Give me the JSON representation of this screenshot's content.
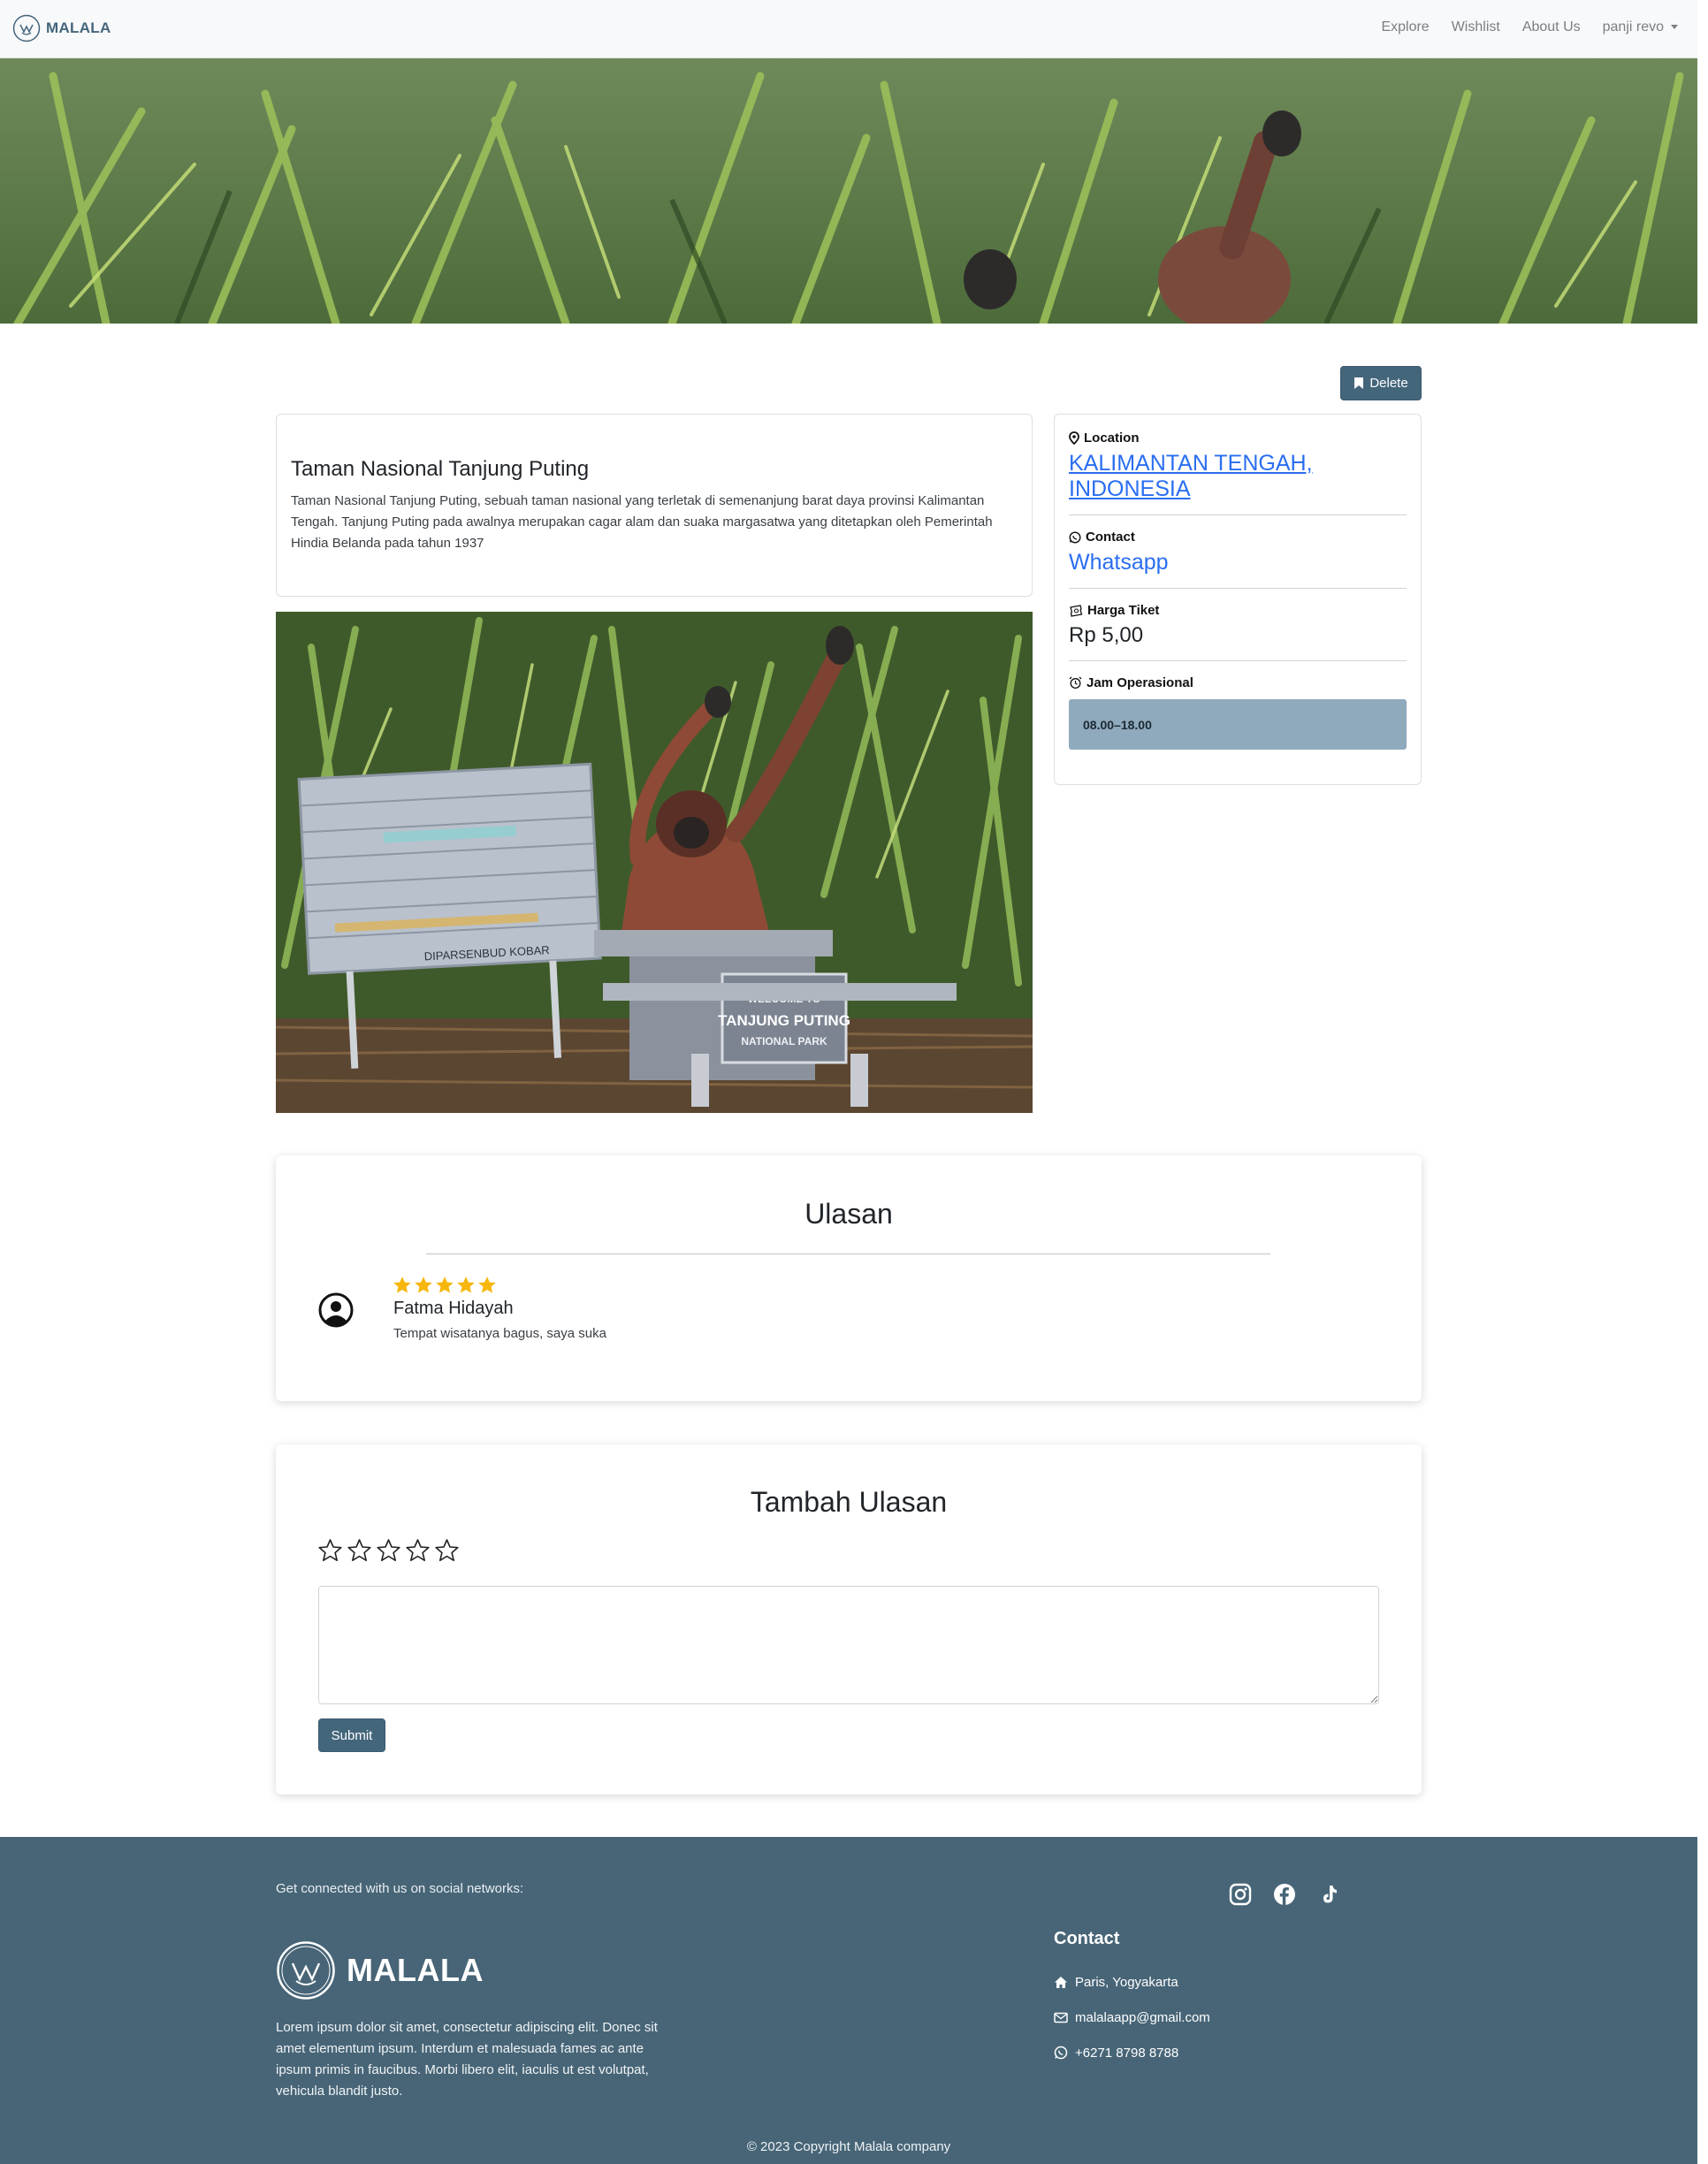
{
  "navbar": {
    "brand": "MALALA",
    "links": [
      "Explore",
      "Wishlist",
      "About Us"
    ],
    "user": "panji revo"
  },
  "actions": {
    "delete_label": "Delete"
  },
  "place": {
    "title": "Taman Nasional Tanjung Puting",
    "description": "Taman Nasional Tanjung Puting, sebuah taman nasional yang terletak di semenanjung barat daya provinsi Kalimantan Tengah. Tanjung Puting pada awalnya merupakan cagar alam dan suaka margasatwa yang ditetapkan oleh Pemerintah Hindia Belanda pada tahun 1937",
    "photo_sign_lines": [
      "WELCOME TO",
      "TANJUNG PUTING",
      "NATIONAL PARK"
    ],
    "photo_board_label": "DIPARSENBUD KOBAR"
  },
  "info": {
    "location_label": "Location",
    "location_value": "KALIMANTAN TENGAH, INDONESIA",
    "contact_label": "Contact",
    "contact_value": "Whatsapp",
    "ticket_label": "Harga Tiket",
    "ticket_value": "Rp 5,00",
    "hours_label": "Jam Operasional",
    "hours_value": "08.00–18.00"
  },
  "reviews": {
    "title": "Ulasan",
    "items": [
      {
        "name": "Fatma Hidayah",
        "rating": 5,
        "text": "Tempat wisatanya bagus, saya suka"
      }
    ]
  },
  "add_review": {
    "title": "Tambah Ulasan",
    "rating": 0,
    "max_rating": 5,
    "textarea_value": "",
    "submit_label": "Submit"
  },
  "footer": {
    "social_text": "Get connected with us on social networks:",
    "social_icons": [
      "instagram-icon",
      "facebook-icon",
      "tiktok-icon"
    ],
    "brand": "MALALA",
    "description": "Lorem ipsum dolor sit amet, consectetur adipiscing elit. Donec sit amet elementum ipsum. Interdum et malesuada fames ac ante ipsum primis in faucibus. Morbi libero elit, iaculis ut est volutpat, vehicula blandit justo.",
    "contact_title": "Contact",
    "address": "Paris, Yogyakarta",
    "email": "malalaapp@gmail.com",
    "phone": "+6271 8798 8788",
    "copyright": "© 2023 Copyright Malala company"
  },
  "colors": {
    "primary": "#44667b",
    "footer_bg": "#476577",
    "hours_bg": "#8fa9bd",
    "link": "#2a6ef0",
    "star": "#f6b60b"
  }
}
